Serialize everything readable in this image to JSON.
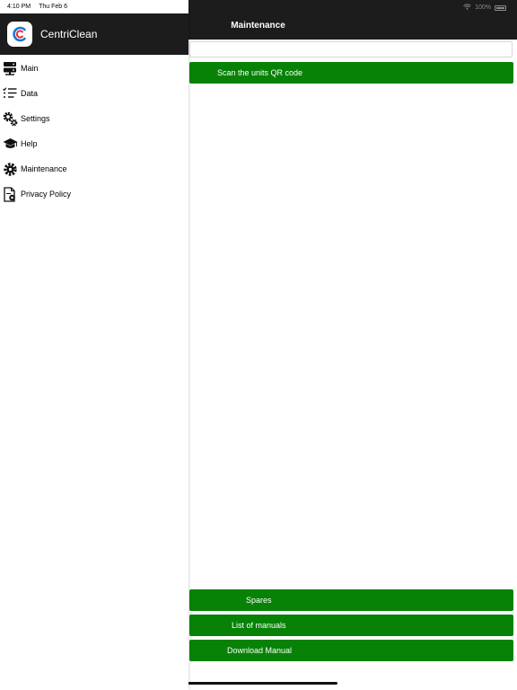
{
  "status_bar": {
    "time": "4:10 PM",
    "date": "Thu Feb 6",
    "battery": "100%"
  },
  "drawer": {
    "app_name": "CentriClean",
    "items": [
      {
        "label": "Main",
        "icon": "server-icon"
      },
      {
        "label": "Data",
        "icon": "checklist-icon"
      },
      {
        "label": "Settings",
        "icon": "gears-icon"
      },
      {
        "label": "Help",
        "icon": "graduation-cap-icon"
      },
      {
        "label": "Maintenance",
        "icon": "gear-icon"
      },
      {
        "label": "Privacy Policy",
        "icon": "document-icon"
      }
    ]
  },
  "main": {
    "title": "Maintenance",
    "search_value": "",
    "scan_button": "Scan the units QR code",
    "spares_button": "Spares",
    "manuals_button": "List of manuals",
    "download_button": "Download Manual"
  },
  "colors": {
    "nav_bar": "#1c1c1c",
    "button_green": "#078207",
    "logo_blue": "#1e73d8",
    "logo_red": "#e8312f"
  }
}
